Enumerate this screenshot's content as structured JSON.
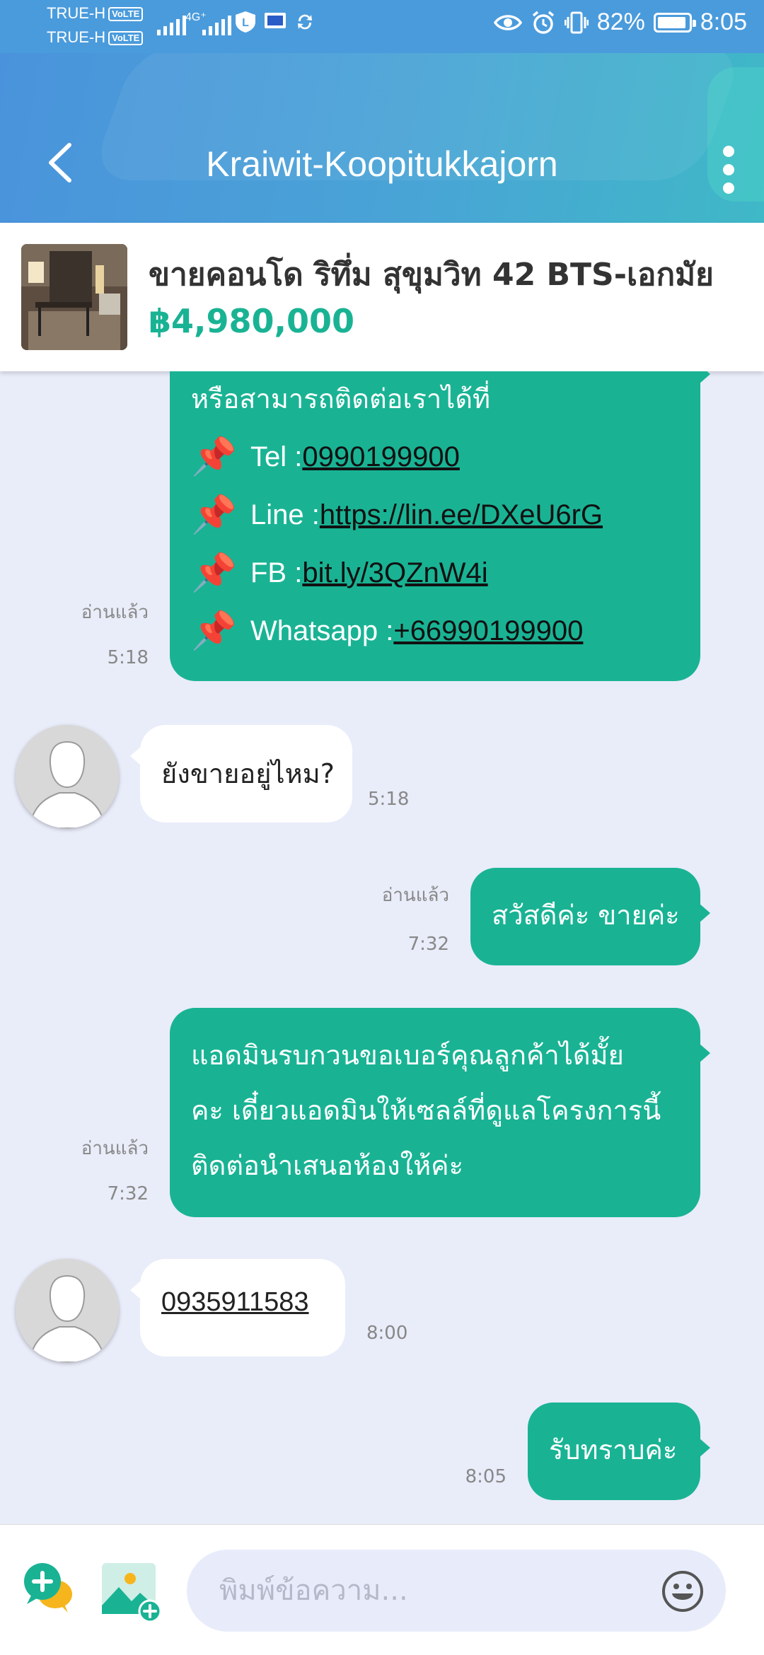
{
  "status_bar": {
    "carrier1": "TRUE-H",
    "carrier2": "TRUE-H",
    "volte": "VoLTE",
    "network": "4G⁺",
    "battery": "82%",
    "battery_level": 0.82,
    "time": "8:05"
  },
  "header": {
    "title": "Kraiwit-Koopitukkajorn"
  },
  "listing": {
    "title": "ขายคอนโด  ริทึ่ม สุขุมวิท 42 BTS-เอกมัย",
    "price": "฿4,980,000"
  },
  "messages": {
    "m1": {
      "intro": "หรือสามารถติดต่อเราได้ที่",
      "tel_label": "Tel : ",
      "tel_value": "0990199900",
      "line_label": "Line : ",
      "line_value": "https://lin.ee/DXeU6rG",
      "fb_label": "FB : ",
      "fb_value": "bit.ly/3QZnW4i",
      "wa_label": "Whatsapp : ",
      "wa_value": "+66990199900",
      "read": "อ่านแล้ว",
      "time": "5:18"
    },
    "m2": {
      "text": "ยังขายอยู่ไหม?",
      "time": "5:18"
    },
    "m3": {
      "text": "สวัสดีค่ะ ขายค่ะ",
      "read": "อ่านแล้ว",
      "time": "7:32"
    },
    "m4": {
      "line1": "แอดมินรบกวนขอเบอร์คุณลูกค้าได้มั้ย",
      "line2": "คะ เดี๋ยวแอดมินให้เซลล์ที่ดูแลโครงการนี้",
      "line3": "ติดต่อนำเสนอห้องให้ค่ะ",
      "read": "อ่านแล้ว",
      "time": "7:32"
    },
    "m5": {
      "text": "0935911583",
      "time": "8:00"
    },
    "m6": {
      "text": "รับทราบค่ะ",
      "time": "8:05"
    }
  },
  "input": {
    "placeholder": "พิมพ์ข้อความ..."
  }
}
